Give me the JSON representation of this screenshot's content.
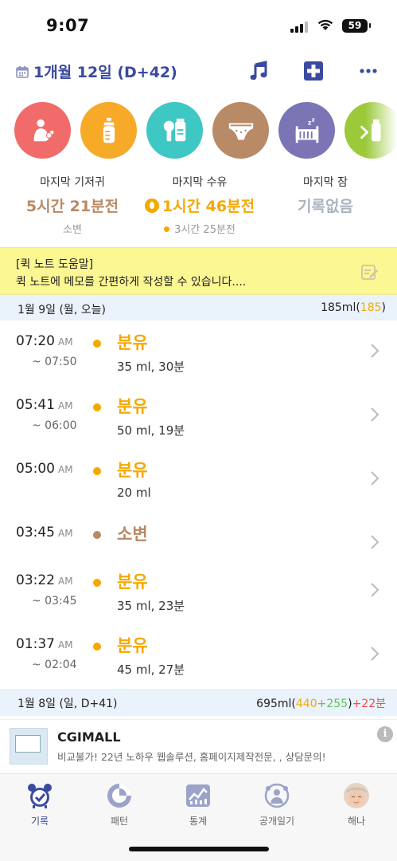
{
  "status_bar": {
    "time": "9:07",
    "battery": "59"
  },
  "header": {
    "date_title": "1개월 12일 (D+42)"
  },
  "categories": [
    {
      "icon": "breastfeed-icon",
      "color": "#f26b6b"
    },
    {
      "icon": "bottle-icon",
      "color": "#f7a928"
    },
    {
      "icon": "pumping-icon",
      "color": "#3ec7c3"
    },
    {
      "icon": "diaper-icon",
      "color": "#b98a66"
    },
    {
      "icon": "sleep-icon",
      "color": "#7b75b6"
    },
    {
      "icon": "baby-food-icon",
      "color": "#9bc93a"
    }
  ],
  "summary": {
    "diaper": {
      "label": "마지막 기저귀",
      "value": "5시간 21분전",
      "sub": "소변"
    },
    "feeding": {
      "label": "마지막 수유",
      "value": "1시간 46분전",
      "sub": "3시간 25분전"
    },
    "sleep": {
      "label": "마지막 잠",
      "value": "기록없음"
    }
  },
  "quick_note": {
    "title": "[퀵 노트 도움말]",
    "text": "퀵 노트에 메모를 간편하게 작성할 수 있습니다...."
  },
  "day1": {
    "title": "1월 9일 (월, 오늘)",
    "total": "185ml",
    "paren_open": "(",
    "paren_value": "185",
    "paren_close": ")"
  },
  "entries": [
    {
      "time": "07:20",
      "ampm": "AM",
      "end": "~ 07:50",
      "type": "분유",
      "detail": "35 ml, 30분"
    },
    {
      "time": "05:41",
      "ampm": "AM",
      "end": "~ 06:00",
      "type": "분유",
      "detail": "50 ml, 19분"
    },
    {
      "time": "05:00",
      "ampm": "AM",
      "end": "",
      "type": "분유",
      "detail": "20 ml"
    },
    {
      "time": "03:45",
      "ampm": "AM",
      "end": "",
      "type": "소변",
      "detail": ""
    },
    {
      "time": "03:22",
      "ampm": "AM",
      "end": "~ 03:45",
      "type": "분유",
      "detail": "35 ml, 23분"
    },
    {
      "time": "01:37",
      "ampm": "AM",
      "end": "~ 02:04",
      "type": "분유",
      "detail": "45 ml, 27분"
    }
  ],
  "day2": {
    "title": "1월 8일 (일, D+41)",
    "total": "695ml",
    "p_open": "(",
    "v1": "440",
    "plus1": "+",
    "v2": "255",
    "p_close": ")",
    "plus2": "+",
    "v3": "22분"
  },
  "ad": {
    "title": "CGIMALL",
    "desc": "비교불가! 22년 노하우 웹솔루션, 홈페이지제작전문, , 상담문의!",
    "info": "i"
  },
  "tabs": [
    {
      "label": "기록",
      "icon": "alarm-clock-icon"
    },
    {
      "label": "패턴",
      "icon": "pattern-icon"
    },
    {
      "label": "통계",
      "icon": "chart-icon"
    },
    {
      "label": "공개일기",
      "icon": "community-icon"
    },
    {
      "label": "해나",
      "icon": "baby-avatar"
    }
  ],
  "colors": {
    "accent": "#3b4aa0",
    "feeding": "#f5a800",
    "diaper": "#b98a66",
    "quick_note_bg": "#fbf792",
    "day_header_bg": "#eaf2fb"
  }
}
